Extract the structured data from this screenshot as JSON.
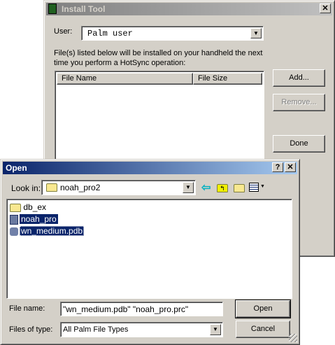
{
  "install_tool": {
    "title": "Install Tool",
    "user_label": "User:",
    "user_value": "Palm user",
    "description_line1": "File(s) listed below will be installed on your handheld the next",
    "description_line2": "time you perform a HotSync operation:",
    "columns": [
      "File Name",
      "File Size"
    ],
    "buttons": {
      "add": "Add...",
      "remove": "Remove...",
      "done": "Done"
    },
    "close": "✕"
  },
  "open_dialog": {
    "title": "Open",
    "help": "?",
    "close": "✕",
    "look_in_label": "Look in:",
    "look_in_value": "noah_pro2",
    "files": [
      {
        "name": "db_ex",
        "icon": "folder-icon"
      },
      {
        "name": "noah_pro",
        "icon": "palm-app-icon"
      },
      {
        "name": "wn_medium.pdb",
        "icon": "palm-database-icon"
      }
    ],
    "file_name_label": "File name:",
    "file_name_value": "\"wn_medium.pdb\" \"noah_pro.prc\"",
    "files_of_type_label": "Files of type:",
    "files_of_type_value": "All Palm File Types",
    "buttons": {
      "open": "Open",
      "cancel": "Cancel"
    }
  },
  "colors": {
    "title_active": "#0a246a",
    "title_inactive": "#808080",
    "selection": "#0a246a"
  }
}
